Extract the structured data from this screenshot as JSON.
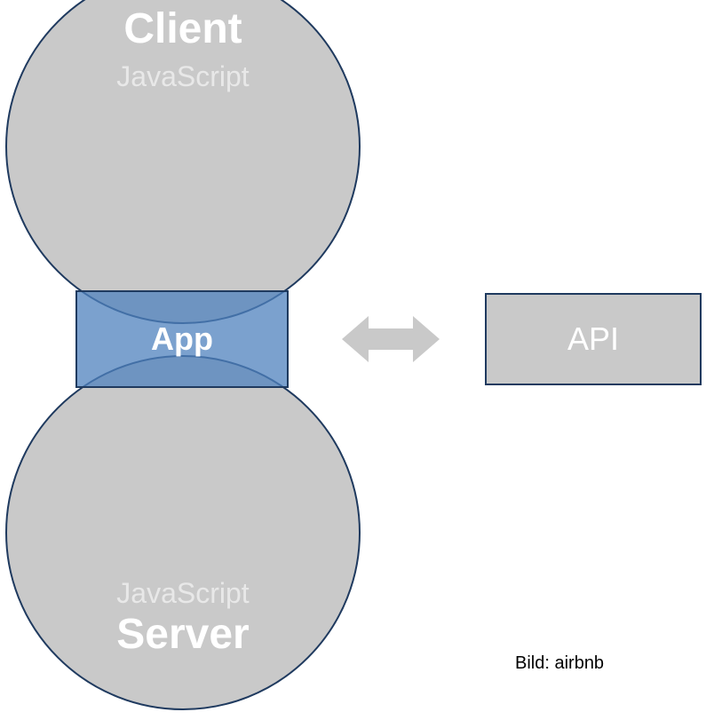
{
  "client": {
    "title": "Client",
    "subtitle": "JavaScript"
  },
  "server": {
    "title": "Server",
    "subtitle": "JavaScript"
  },
  "app": {
    "label": "App"
  },
  "api": {
    "label": "API"
  },
  "attribution": "Bild: airbnb"
}
